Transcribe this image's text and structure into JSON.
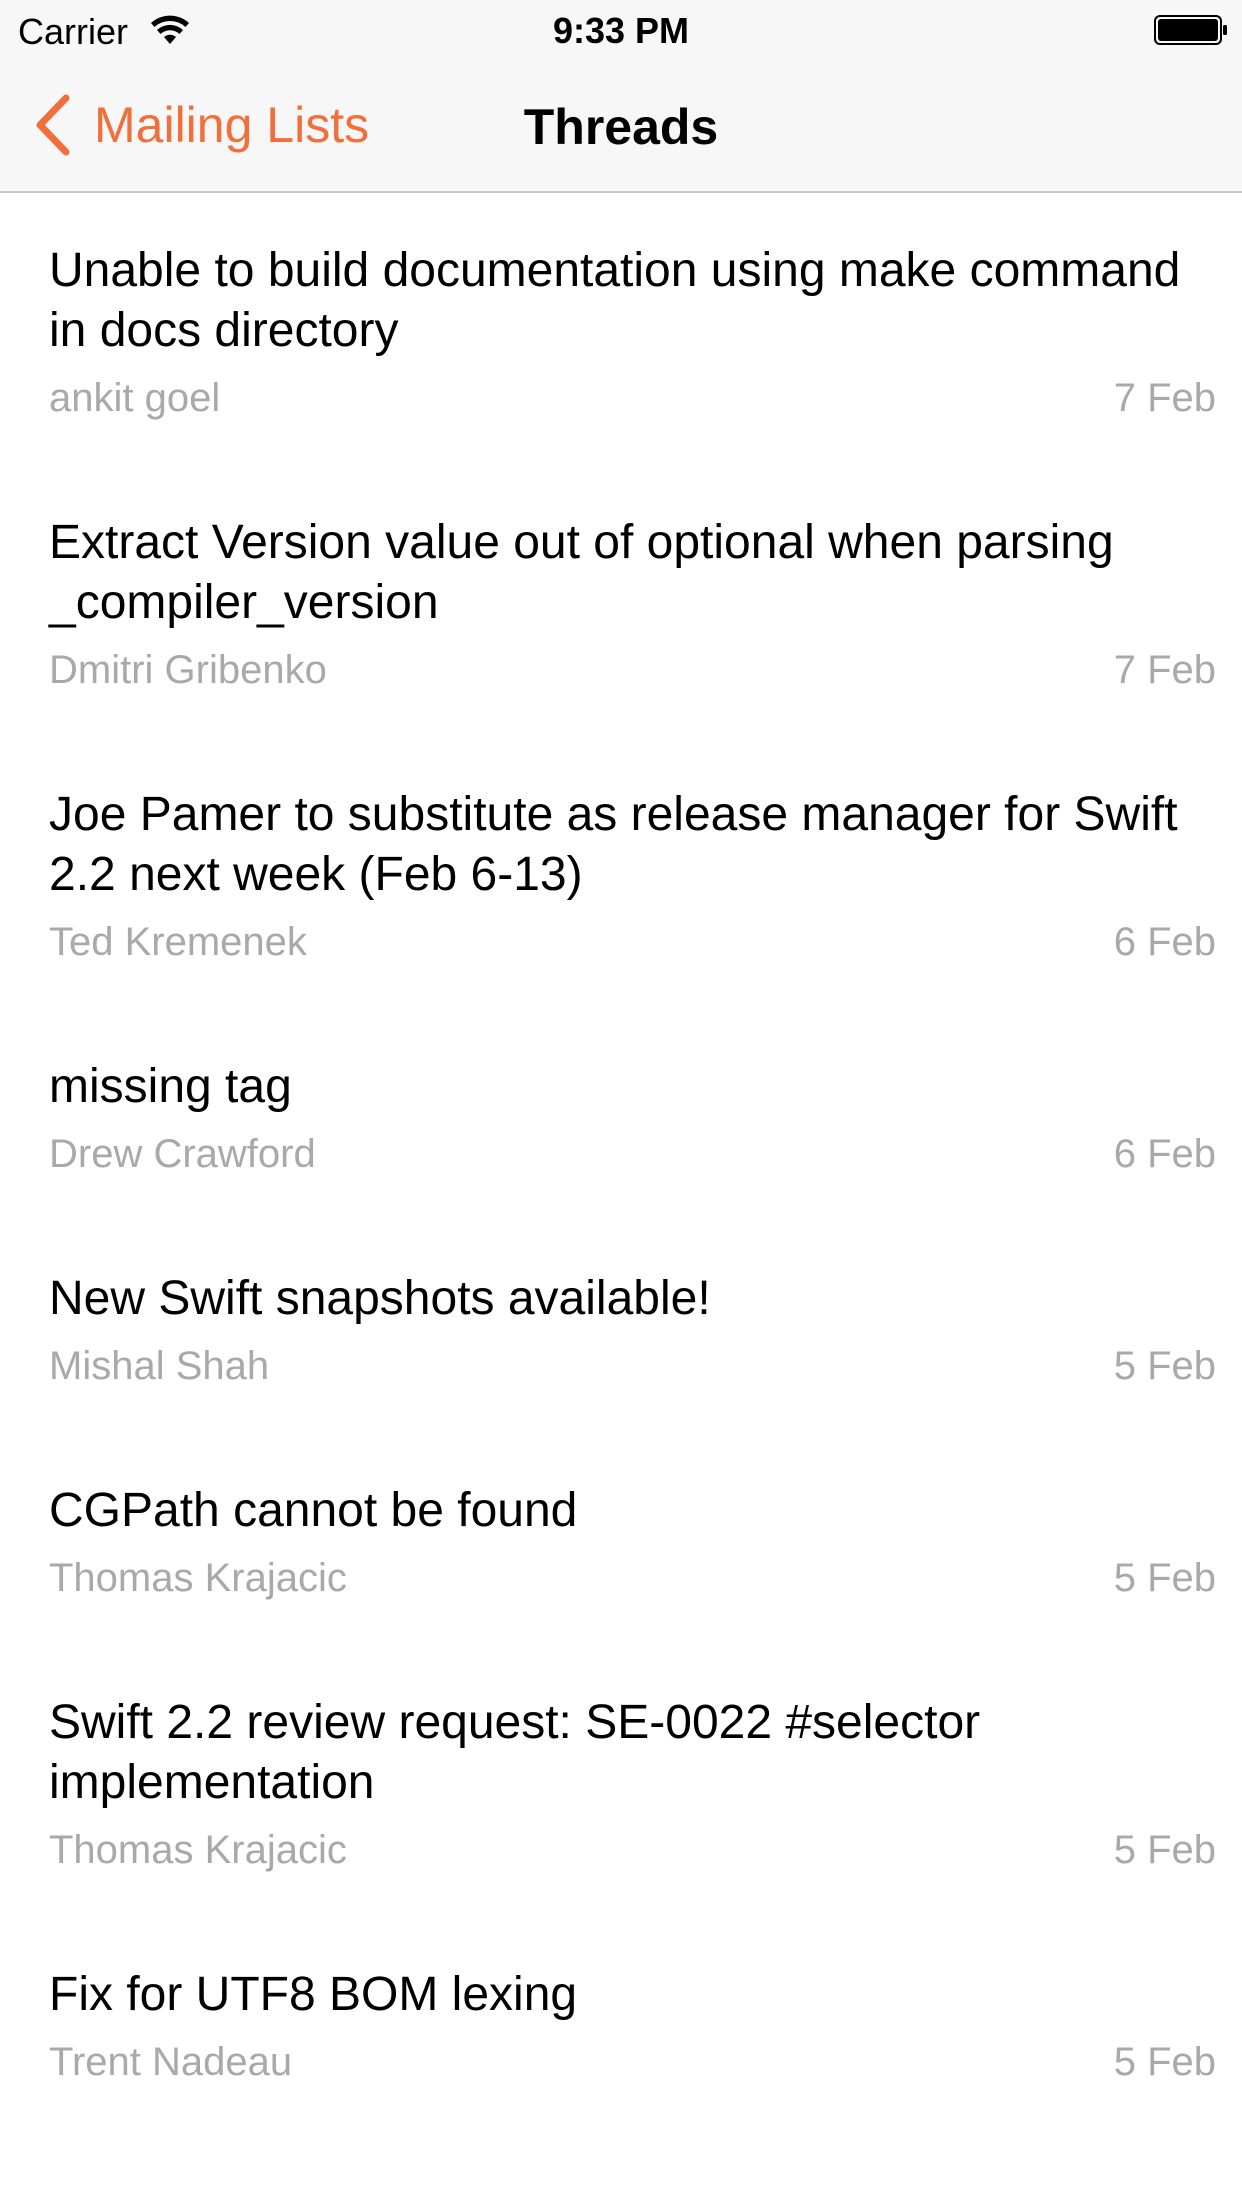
{
  "status_bar": {
    "carrier": "Carrier",
    "time": "9:33 PM",
    "icons": [
      "wifi-icon",
      "battery-icon"
    ]
  },
  "nav": {
    "back_label": "Mailing Lists",
    "title": "Threads",
    "accent_color": "#f26f3b"
  },
  "threads": [
    {
      "title": "Unable to build documentation using make command in docs directory",
      "author": "ankit goel",
      "date": "7 Feb"
    },
    {
      "title": "Extract Version value out of optional when parsing _compiler_version",
      "author": "Dmitri Gribenko",
      "date": "7 Feb"
    },
    {
      "title": "Joe Pamer to substitute as release manager for Swift 2.2 next week (Feb 6-13)",
      "author": "Ted Kremenek",
      "date": "6 Feb"
    },
    {
      "title": "missing tag",
      "author": "Drew Crawford",
      "date": "6 Feb"
    },
    {
      "title": "New Swift snapshots available!",
      "author": "Mishal Shah",
      "date": "5 Feb"
    },
    {
      "title": "CGPath cannot be found",
      "author": "Thomas Krajacic",
      "date": "5 Feb"
    },
    {
      "title": "Swift 2.2 review request: SE-0022 #selector implementation",
      "author": "Thomas Krajacic",
      "date": "5 Feb"
    },
    {
      "title": "Fix for UTF8 BOM lexing",
      "author": "Trent Nadeau",
      "date": "5 Feb"
    }
  ]
}
